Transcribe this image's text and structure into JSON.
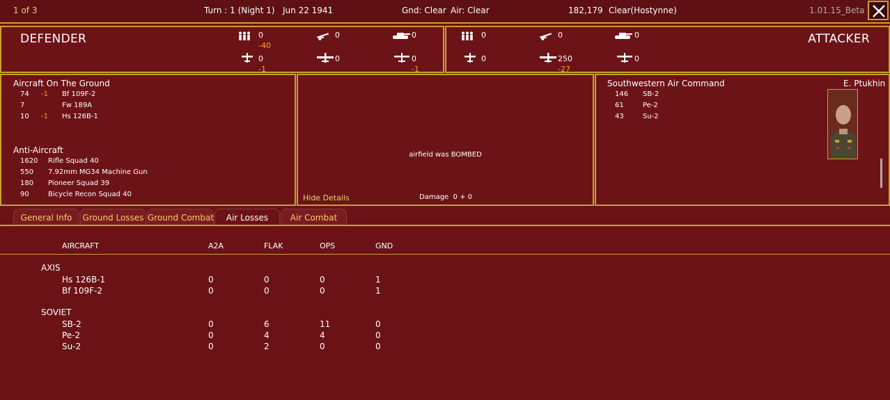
{
  "topbar": {
    "page": "1 of 3",
    "turn": "Turn : 1 (Night 1)",
    "date": "Jun 22 1941",
    "ground_weather": "Gnd: Clear",
    "air_weather": "Air: Clear",
    "location_id": "182,179",
    "location": "Clear(Hostynne)",
    "version": "1.01.15_Beta"
  },
  "defender": {
    "title": "DEFENDER",
    "infantry": "0",
    "infantry_loss": "-40",
    "artillery": "0",
    "tanks": "0",
    "fighters": "0",
    "fighters_loss": "-1",
    "bombers": "0",
    "recon": "0",
    "recon_loss": "-1"
  },
  "attacker": {
    "title": "ATTACKER",
    "infantry": "0",
    "artillery": "0",
    "tanks": "0",
    "fighters": "0",
    "bombers": "250",
    "bombers_loss": "-27",
    "recon": "0"
  },
  "left_panel": {
    "ground_title": "Aircraft On The Ground",
    "ground": [
      {
        "count": "74",
        "loss": "-1",
        "name": "Bf 109F-2"
      },
      {
        "count": "7",
        "loss": "",
        "name": "Fw 189A"
      },
      {
        "count": "10",
        "loss": "-1",
        "name": "Hs 126B-1"
      }
    ],
    "aa_title": "Anti-Aircraft",
    "aa": [
      {
        "count": "1620",
        "name": "Rifle Squad 40"
      },
      {
        "count": "550",
        "name": "7.92mm MG34 Machine Gun"
      },
      {
        "count": "180",
        "name": "Pioneer Squad 39"
      },
      {
        "count": "90",
        "name": "Bicycle Recon Squad 40"
      }
    ]
  },
  "center_panel": {
    "message": "airfield was BOMBED",
    "hide_details": "Hide Details",
    "damage": "Damage  0 + 0"
  },
  "right_panel": {
    "command": "Southwestern Air Command",
    "commander": "E. Ptukhin",
    "aircraft": [
      {
        "count": "146",
        "name": "SB-2"
      },
      {
        "count": "61",
        "name": "Pe-2"
      },
      {
        "count": "43",
        "name": "Su-2"
      }
    ]
  },
  "tabs": [
    {
      "label": "General Info"
    },
    {
      "label": "Ground Losses"
    },
    {
      "label": "Ground Combat"
    },
    {
      "label": "Air Losses"
    },
    {
      "label": "Air Combat"
    }
  ],
  "table": {
    "headers": [
      "AIRCRAFT",
      "A2A",
      "FLAK",
      "OPS",
      "GND"
    ],
    "groups": [
      {
        "name": "AXIS",
        "rows": [
          [
            "Hs 126B-1",
            "0",
            "0",
            "0",
            "1"
          ],
          [
            "Bf 109F-2",
            "0",
            "0",
            "0",
            "1"
          ]
        ]
      },
      {
        "name": "SOVIET",
        "rows": [
          [
            "SB-2",
            "0",
            "6",
            "11",
            "0"
          ],
          [
            "Pe-2",
            "0",
            "4",
            "4",
            "0"
          ],
          [
            "Su-2",
            "0",
            "2",
            "0",
            "0"
          ]
        ]
      }
    ]
  },
  "colors": {
    "background": "#6a1216",
    "border": "#c9a227",
    "loss": "#f5a623",
    "tab_text": "#f2d16b"
  }
}
